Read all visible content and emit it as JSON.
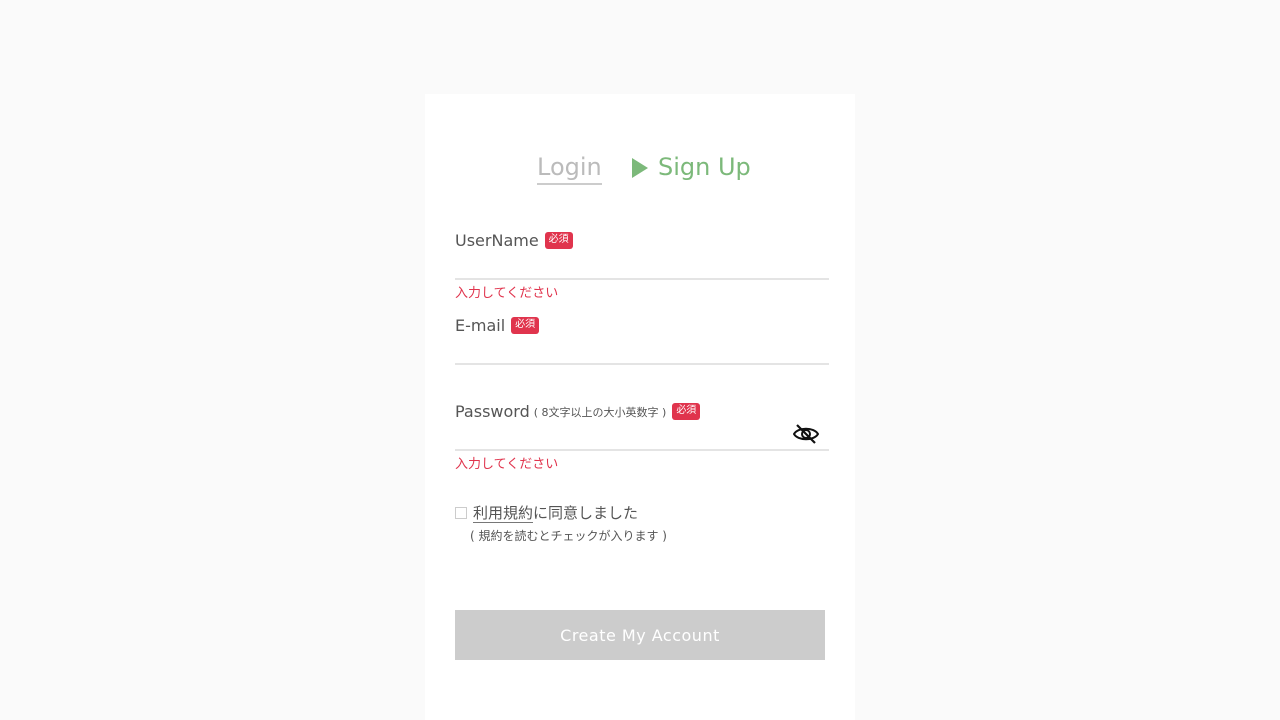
{
  "tabs": {
    "login_label": "Login",
    "signup_label": "Sign Up",
    "active": "Sign Up"
  },
  "form": {
    "username": {
      "label": "UserName",
      "required_badge": "必須",
      "value": "",
      "error": "入力してください"
    },
    "email": {
      "label": "E-mail",
      "required_badge": "必須",
      "value": ""
    },
    "password": {
      "label": "Password",
      "hint": "( 8文字以上の大小英数字 )",
      "required_badge": "必須",
      "value": "",
      "error": "入力してください",
      "toggle_icon": "eye-slash-icon"
    },
    "terms": {
      "link_text": "利用規約",
      "text": "に同意しました",
      "note": "( 規約を読むとチェックが入ります )",
      "checked": false
    },
    "submit_label": "Create My Account"
  },
  "colors": {
    "accent_green": "#7cb97a",
    "required_red": "#e0344d",
    "button_disabled": "#cccccc",
    "background": "#fafafa"
  }
}
